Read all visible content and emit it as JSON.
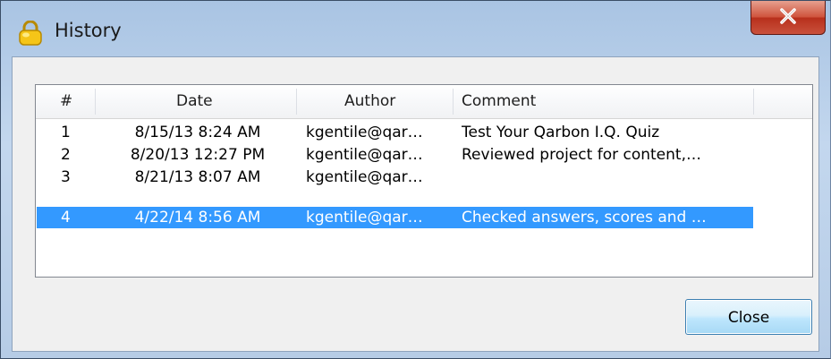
{
  "window": {
    "title": "History",
    "close_glyph": "X",
    "app_icon": "padlock-icon"
  },
  "table": {
    "columns": [
      "#",
      "Date",
      "Author",
      "Comment"
    ],
    "rows": [
      {
        "num": "1",
        "date": "8/15/13 8:24 AM",
        "author": "kgentile@qar…",
        "comment": "Test Your Qarbon I.Q. Quiz"
      },
      {
        "num": "2",
        "date": "8/20/13 12:27 PM",
        "author": "kgentile@qar…",
        "comment": "Reviewed project for content,…"
      },
      {
        "num": "3",
        "date": "8/21/13 8:07 AM",
        "author": "kgentile@qar…",
        "comment": ""
      },
      {
        "num": "4",
        "date": "4/22/14 8:56 AM",
        "author": "kgentile@qar…",
        "comment": "Checked answers, scores and …"
      }
    ],
    "selected_row": "4"
  },
  "buttons": {
    "close_label": "Close"
  },
  "colors": {
    "selection": "#3399ff",
    "title_close": "#c9513c"
  }
}
